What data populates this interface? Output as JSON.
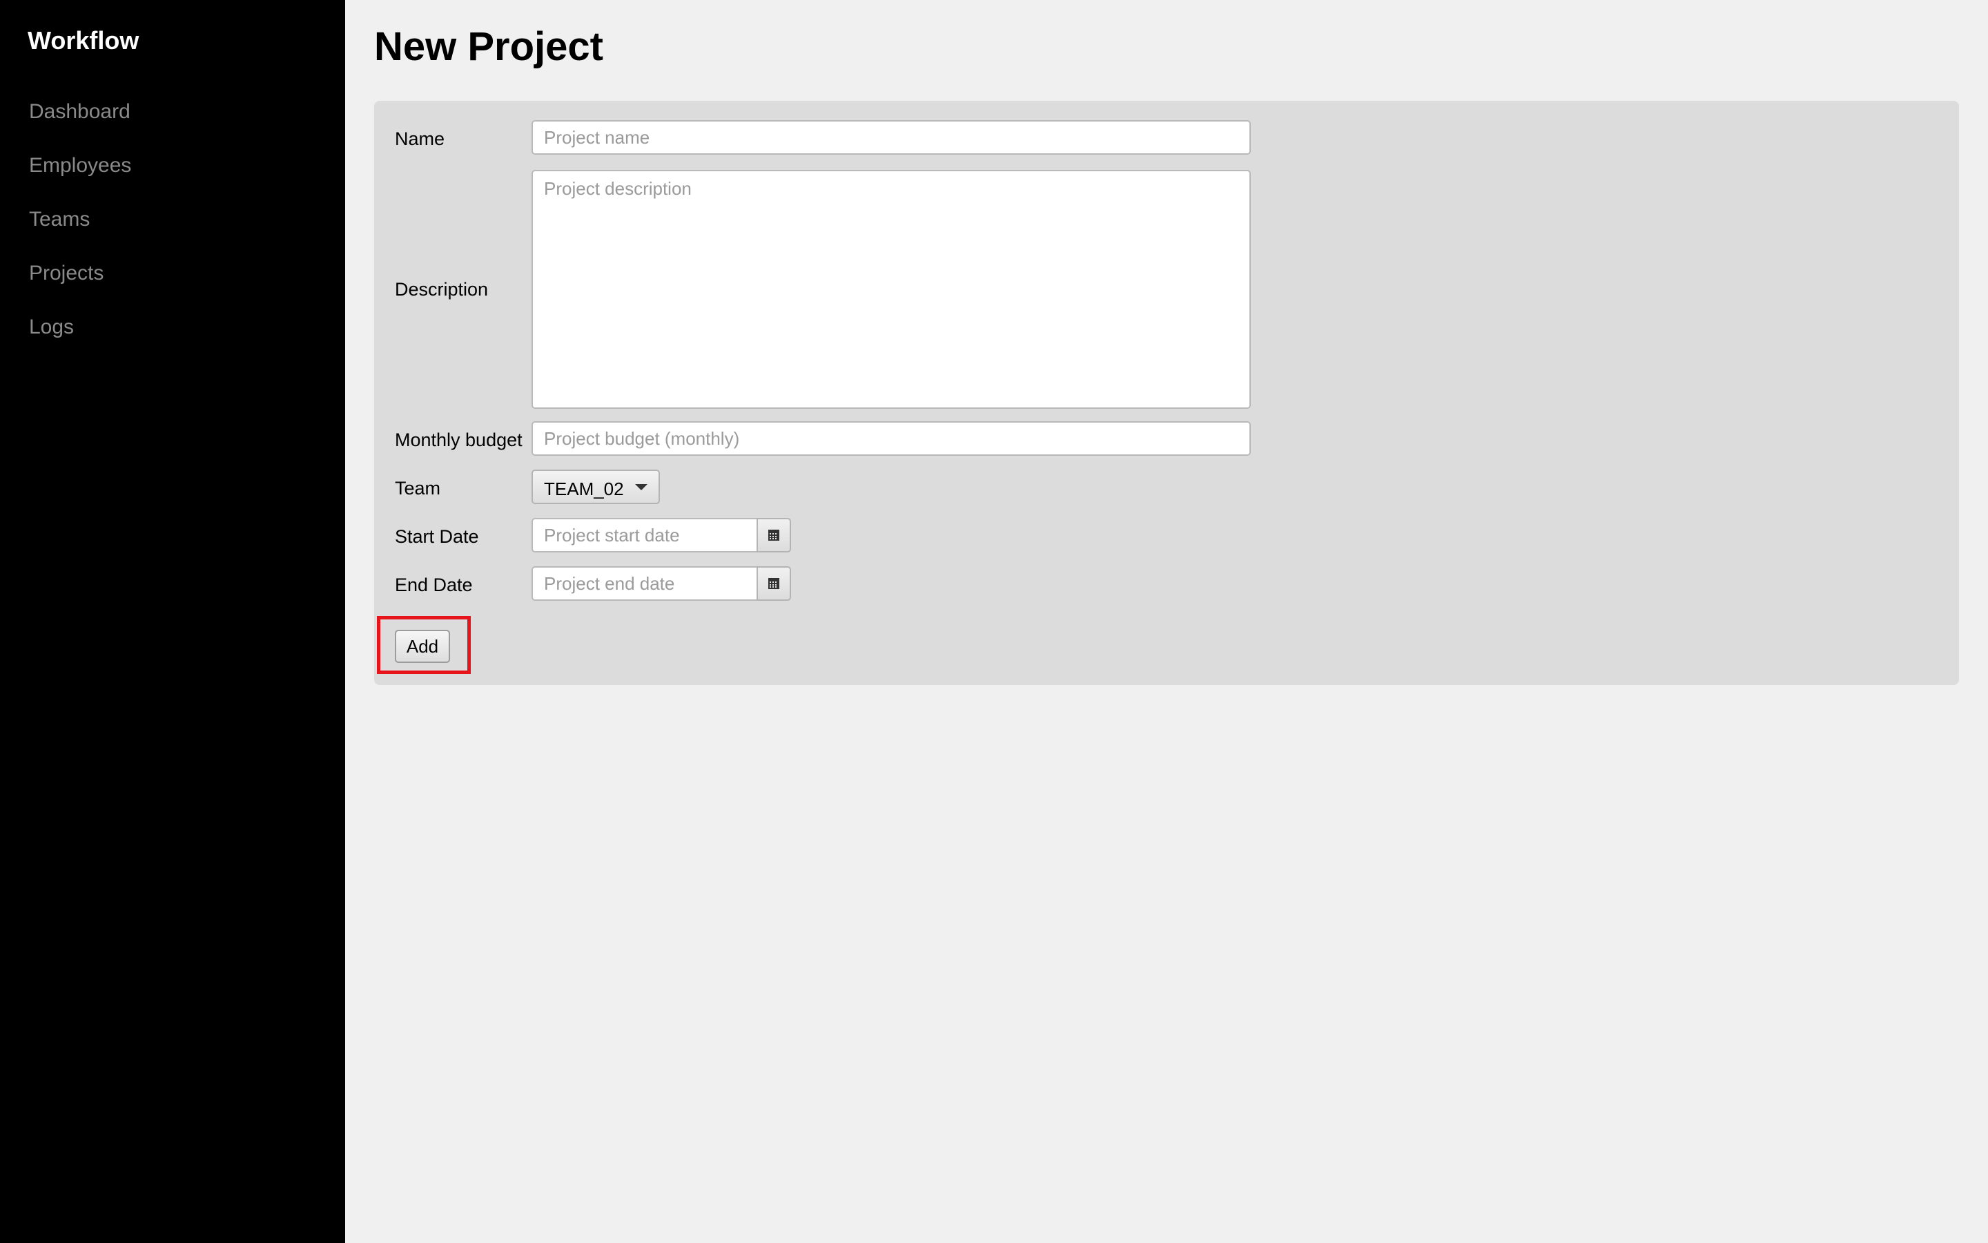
{
  "sidebar": {
    "brand": "Workflow",
    "items": [
      {
        "label": "Dashboard"
      },
      {
        "label": "Employees"
      },
      {
        "label": "Teams"
      },
      {
        "label": "Projects"
      },
      {
        "label": "Logs"
      }
    ]
  },
  "main": {
    "title": "New Project",
    "form": {
      "name": {
        "label": "Name",
        "placeholder": "Project name",
        "value": ""
      },
      "description": {
        "label": "Description",
        "placeholder": "Project description",
        "value": ""
      },
      "budget": {
        "label": "Monthly budget",
        "placeholder": "Project budget (monthly)",
        "value": ""
      },
      "team": {
        "label": "Team",
        "selected": "TEAM_02"
      },
      "start_date": {
        "label": "Start Date",
        "placeholder": "Project start date",
        "value": ""
      },
      "end_date": {
        "label": "End Date",
        "placeholder": "Project end date",
        "value": ""
      },
      "submit_label": "Add"
    }
  },
  "icons": {
    "calendar": "calendar-icon",
    "dropdown": "caret-down-icon"
  },
  "colors": {
    "sidebar_bg": "#000000",
    "nav_text": "#8a8a8a",
    "panel_bg": "#dcdcdc",
    "page_bg": "#f0f0f0",
    "highlight": "#e8141c"
  }
}
